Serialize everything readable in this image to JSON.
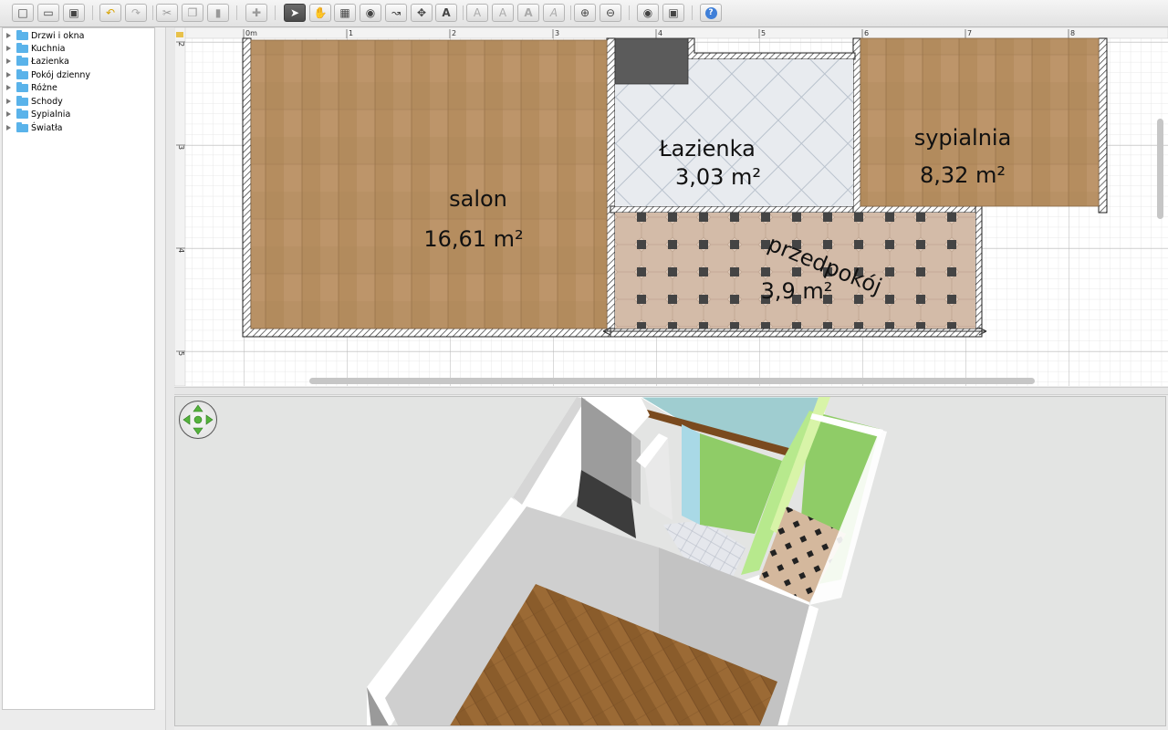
{
  "toolbar": {
    "buttons": [
      "new",
      "open",
      "save",
      "undo",
      "redo",
      "cut",
      "copy",
      "paste",
      "add-furniture",
      "select",
      "pan",
      "create-walls",
      "create-rooms",
      "create-dimensions",
      "create-labels",
      "add-text",
      "text-style-1",
      "text-style-2",
      "text-bold",
      "text-italic",
      "zoom-in",
      "zoom-out",
      "create-photo",
      "create-video",
      "help"
    ],
    "active": "select"
  },
  "tree": {
    "items": [
      "Drzwi i okna",
      "Kuchnia",
      "Łazienka",
      "Pokój dzienny",
      "Różne",
      "Schody",
      "Sypialnia",
      "Światła"
    ]
  },
  "plan": {
    "ruler_x": [
      "0m",
      "1",
      "2",
      "3",
      "4",
      "5",
      "6",
      "7",
      "8"
    ],
    "ruler_y": [
      "2",
      "3",
      "4",
      "5"
    ],
    "rooms": [
      {
        "name": "salon",
        "area": "16,61 m²"
      },
      {
        "name": "Łazienka",
        "area": "3,03 m²"
      },
      {
        "name": "sypialnia",
        "area": "8,32 m²"
      },
      {
        "name": "przedpokój",
        "area": "3,9 m²"
      }
    ]
  },
  "colors": {
    "wood_floor": "#b58d5f",
    "tile_floor": "#e6e9ee",
    "hall_floor": "#d9c6b6",
    "wall_3d": "#bdbdbd",
    "green_wall": "#9fd56e",
    "selection": "#4a4a4a"
  },
  "view3d": {
    "navigator": "navigation-arrows-icon"
  }
}
